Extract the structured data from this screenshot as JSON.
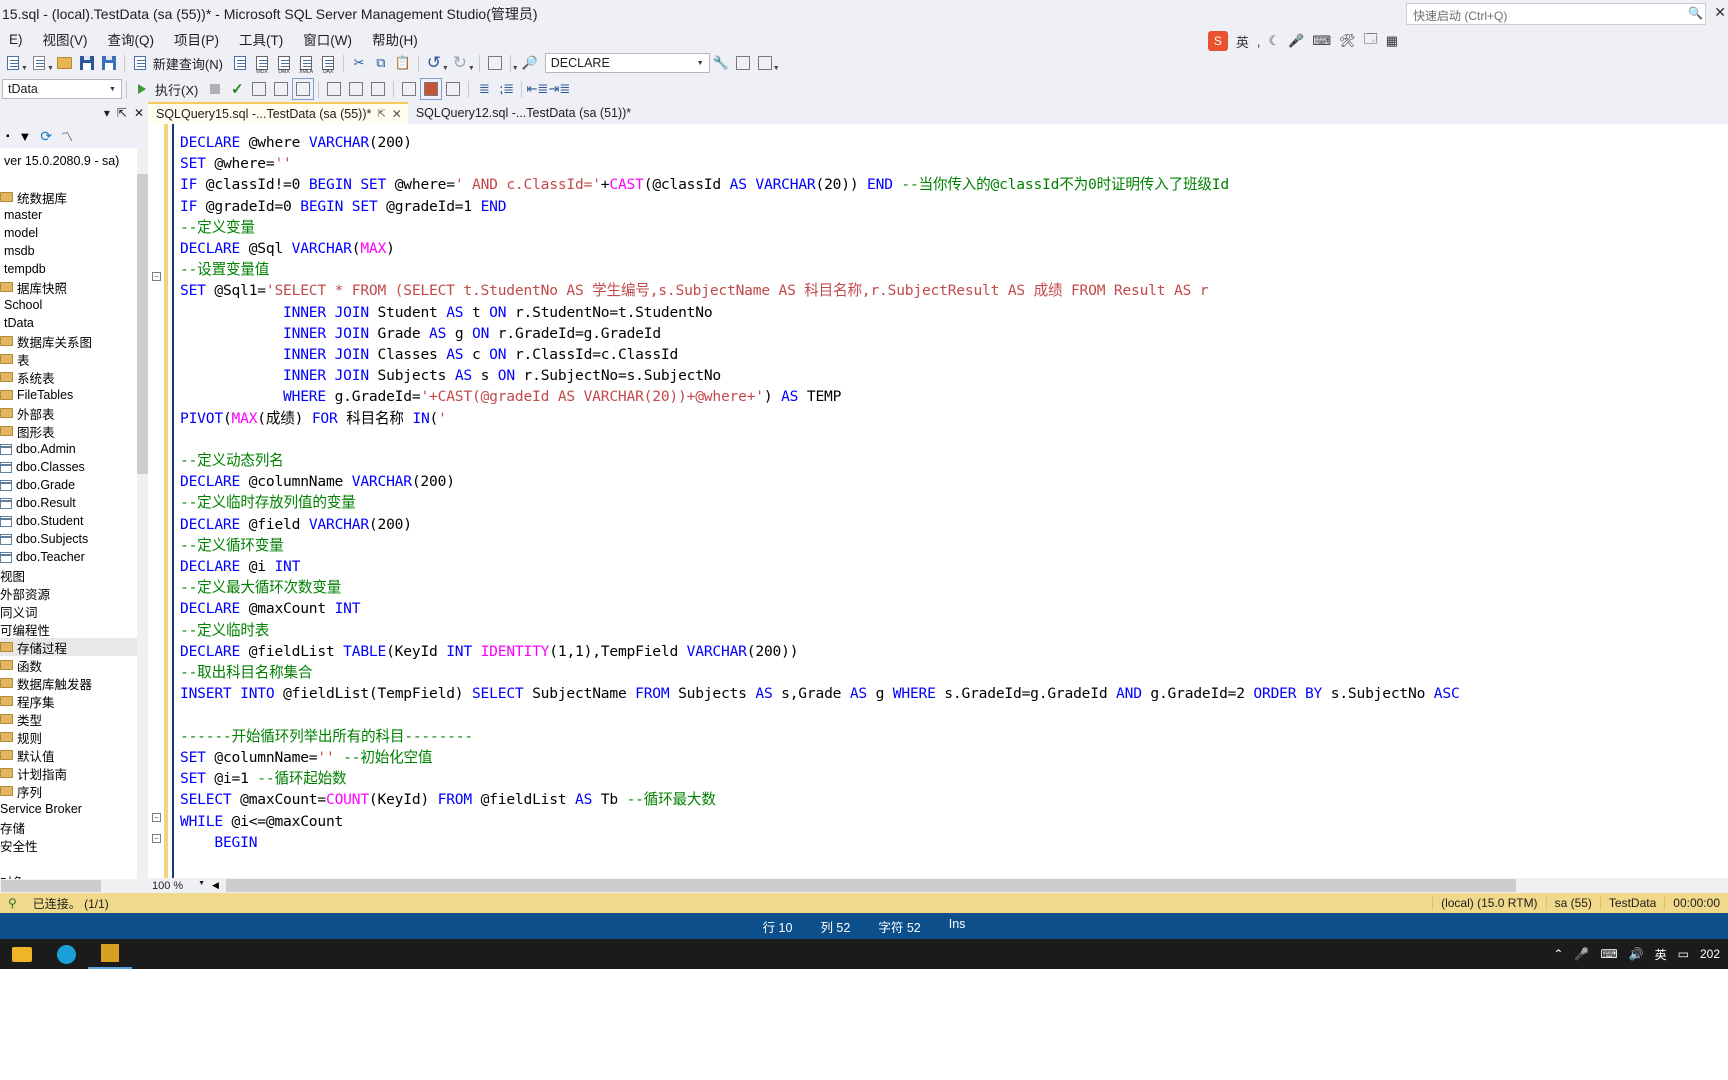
{
  "window": {
    "title": "15.sql - (local).TestData (sa (55))* - Microsoft SQL Server Management Studio(管理员)",
    "close_glyph": "✕"
  },
  "quick_launch": {
    "placeholder": "快速启动 (Ctrl+Q)",
    "icon": "search-icon"
  },
  "menu": {
    "items": [
      "E)",
      "视图(V)",
      "查询(Q)",
      "项目(P)",
      "工具(T)",
      "窗口(W)",
      "帮助(H)"
    ]
  },
  "toolbar1": {
    "new_query_label": "新建查询(N)",
    "declare_combo": "DECLARE",
    "items": [
      "new-item",
      "open-folder",
      "save",
      "save-all",
      "new-query",
      "mdx",
      "dmx",
      "xmla",
      "dax",
      "cut",
      "copy",
      "paste",
      "undo",
      "redo",
      "window-layout",
      "find"
    ]
  },
  "toolbar2": {
    "db_combo": "tData",
    "execute_label": "执行(X)",
    "items": [
      "execute",
      "stop",
      "parse",
      "display-estimated-plan",
      "include-actual-plan",
      "include-client-stats",
      "results-to-text",
      "results-to-grid",
      "results-to-file",
      "comment",
      "uncomment",
      "indent",
      "outdent"
    ]
  },
  "ime": {
    "lang": "英",
    "mark": ","
  },
  "object_explorer": {
    "panel_title": "",
    "header_icons": [
      "chevron-down-icon",
      "pin-icon",
      "close-icon"
    ],
    "toolbar_icons": [
      "connect-icon",
      "disconnect-icon",
      "filter-icon",
      "refresh-icon",
      "activity-monitor-icon"
    ],
    "items": [
      {
        "label": "ver 15.0.2080.9 - sa)",
        "icon": "server-icon",
        "indent": 0
      },
      {
        "label": "",
        "icon": "none",
        "indent": 0
      },
      {
        "label": "统数据库",
        "icon": "folder-icon",
        "indent": 1
      },
      {
        "label": "master",
        "icon": "database-icon",
        "indent": 2
      },
      {
        "label": "model",
        "icon": "database-icon",
        "indent": 2
      },
      {
        "label": "msdb",
        "icon": "database-icon",
        "indent": 2
      },
      {
        "label": "tempdb",
        "icon": "database-icon",
        "indent": 2
      },
      {
        "label": "据库快照",
        "icon": "folder-icon",
        "indent": 1
      },
      {
        "label": "School",
        "icon": "database-icon",
        "indent": 1
      },
      {
        "label": "tData",
        "icon": "database-icon",
        "indent": 1
      },
      {
        "label": "数据库关系图",
        "icon": "folder-icon",
        "indent": 1
      },
      {
        "label": "表",
        "icon": "folder-icon",
        "indent": 1
      },
      {
        "label": "系统表",
        "icon": "folder-icon",
        "indent": 2
      },
      {
        "label": "FileTables",
        "icon": "folder-icon",
        "indent": 2
      },
      {
        "label": "外部表",
        "icon": "folder-icon",
        "indent": 2
      },
      {
        "label": "图形表",
        "icon": "folder-icon",
        "indent": 2
      },
      {
        "label": "dbo.Admin",
        "icon": "table-icon",
        "indent": 2
      },
      {
        "label": "dbo.Classes",
        "icon": "table-icon",
        "indent": 2
      },
      {
        "label": "dbo.Grade",
        "icon": "table-icon",
        "indent": 2
      },
      {
        "label": "dbo.Result",
        "icon": "table-icon",
        "indent": 2
      },
      {
        "label": "dbo.Student",
        "icon": "table-icon",
        "indent": 2
      },
      {
        "label": "dbo.Subjects",
        "icon": "table-icon",
        "indent": 2
      },
      {
        "label": "dbo.Teacher",
        "icon": "table-icon",
        "indent": 2
      },
      {
        "label": "视图",
        "icon": "none",
        "indent": 1
      },
      {
        "label": "外部资源",
        "icon": "none",
        "indent": 1
      },
      {
        "label": "同义词",
        "icon": "none",
        "indent": 1
      },
      {
        "label": "可编程性",
        "icon": "none",
        "indent": 1
      },
      {
        "label": "存储过程",
        "icon": "folder-icon",
        "indent": 2,
        "selected": true
      },
      {
        "label": "函数",
        "icon": "folder-icon",
        "indent": 2
      },
      {
        "label": "数据库触发器",
        "icon": "folder-icon",
        "indent": 2
      },
      {
        "label": "程序集",
        "icon": "folder-icon",
        "indent": 2
      },
      {
        "label": "类型",
        "icon": "folder-icon",
        "indent": 2
      },
      {
        "label": "规则",
        "icon": "folder-icon",
        "indent": 2
      },
      {
        "label": "默认值",
        "icon": "folder-icon",
        "indent": 2
      },
      {
        "label": "计划指南",
        "icon": "folder-icon",
        "indent": 2
      },
      {
        "label": "序列",
        "icon": "folder-icon",
        "indent": 2
      },
      {
        "label": "Service Broker",
        "icon": "none",
        "indent": 1
      },
      {
        "label": "存储",
        "icon": "none",
        "indent": 1
      },
      {
        "label": "安全性",
        "icon": "none",
        "indent": 1
      },
      {
        "label": "",
        "icon": "none",
        "indent": 0
      },
      {
        "label": "对象",
        "icon": "none",
        "indent": 0
      }
    ]
  },
  "tabs": [
    {
      "label": "SQLQuery15.sql -...TestData (sa (55))*",
      "active": true,
      "pin": "⇱",
      "close": "✕"
    },
    {
      "label": "SQLQuery12.sql -...TestData (sa (51))*",
      "active": false
    }
  ],
  "editor": {
    "zoom": "100 %",
    "lines": [
      {
        "t": "DECLARE @where VARCHAR(200)"
      },
      {
        "t": "SET @where=''"
      },
      {
        "t": "IF @classId!=0 BEGIN SET @where=' AND c.ClassId='+CAST(@classId AS VARCHAR(20)) END --当你传入的@classId不为0时证明传入了班级Id"
      },
      {
        "t": "IF @gradeId=0 BEGIN SET @gradeId=1 END"
      },
      {
        "t": "--定义变量"
      },
      {
        "t": "DECLARE @Sql VARCHAR(MAX)"
      },
      {
        "t": "--设置变量值"
      },
      {
        "t": "SET @Sql1='SELECT * FROM (SELECT t.StudentNo AS 学生编号,s.SubjectName AS 科目名称,r.SubjectResult AS 成绩 FROM Result AS r"
      },
      {
        "t": "            INNER JOIN Student AS t ON r.StudentNo=t.StudentNo"
      },
      {
        "t": "            INNER JOIN Grade AS g ON r.GradeId=g.GradeId"
      },
      {
        "t": "            INNER JOIN Classes AS c ON r.ClassId=c.ClassId"
      },
      {
        "t": "            INNER JOIN Subjects AS s ON r.SubjectNo=s.SubjectNo"
      },
      {
        "t": "            WHERE g.GradeId='+CAST(@gradeId AS VARCHAR(20))+@where+') AS TEMP"
      },
      {
        "t": "PIVOT(MAX(成绩) FOR 科目名称 IN('"
      },
      {
        "t": ""
      },
      {
        "t": "--定义动态列名"
      },
      {
        "t": "DECLARE @columnName VARCHAR(200)"
      },
      {
        "t": "--定义临时存放列值的变量"
      },
      {
        "t": "DECLARE @field VARCHAR(200)"
      },
      {
        "t": "--定义循环变量"
      },
      {
        "t": "DECLARE @i INT"
      },
      {
        "t": "--定义最大循环次数变量"
      },
      {
        "t": "DECLARE @maxCount INT"
      },
      {
        "t": "--定义临时表"
      },
      {
        "t": "DECLARE @fieldList TABLE(KeyId INT IDENTITY(1,1),TempField VARCHAR(200))"
      },
      {
        "t": "--取出科目名称集合"
      },
      {
        "t": "INSERT INTO @fieldList(TempField) SELECT SubjectName FROM Subjects AS s,Grade AS g WHERE s.GradeId=g.GradeId AND g.GradeId=2 ORDER BY s.SubjectNo ASC"
      },
      {
        "t": ""
      },
      {
        "t": "------开始循环列举出所有的科目--------"
      },
      {
        "t": "SET @columnName='' --初始化空值"
      },
      {
        "t": "SET @i=1 --循环起始数"
      },
      {
        "t": "SELECT @maxCount=COUNT(KeyId) FROM @fieldList AS Tb --循环最大数"
      },
      {
        "t": "WHILE @i<=@maxCount"
      },
      {
        "t": "    BEGIN"
      }
    ]
  },
  "status_bar": {
    "connection_icon": "connected-icon",
    "connected": "已连接。 (1/1)",
    "server": "(local) (15.0 RTM)",
    "user": "sa (55)",
    "database": "TestData",
    "time": "00:00:00"
  },
  "status_bar2": {
    "row_label": "行 10",
    "col_label": "列 52",
    "char_label": "字符 52",
    "ins_label": "Ins"
  },
  "taskbar": {
    "apps": [
      "file-explorer-icon",
      "browser-icon",
      "ssms-icon"
    ],
    "tray": [
      "chevron-up-icon",
      "mic-icon",
      "keyboard-icon",
      "volume-icon",
      "network-icon",
      "ime-icon"
    ],
    "clock": "202"
  },
  "colors": {
    "accent": "#0d4f8b",
    "status_bar": "#f0d98a",
    "tab_active": "#fffcf0",
    "chrome": "#eff0f5",
    "keyword": "#0000ff",
    "string": "#c34a4a",
    "comment": "#008000",
    "function": "#ff00ff"
  }
}
